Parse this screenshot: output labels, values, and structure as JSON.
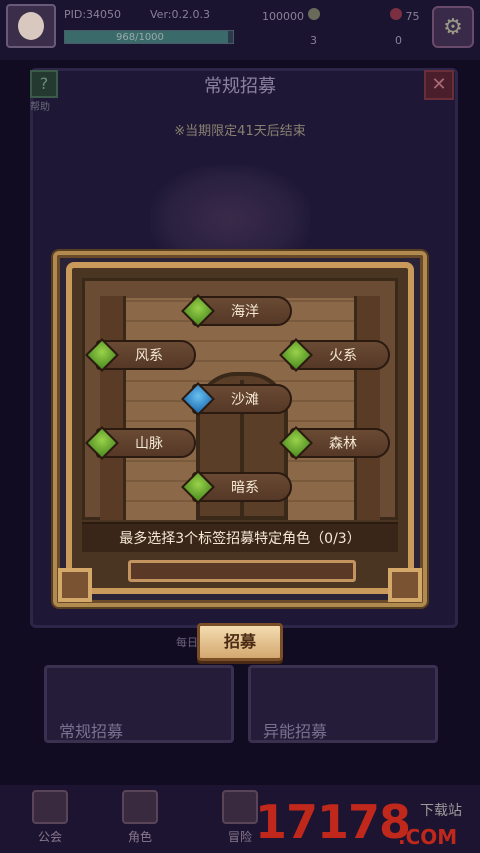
{
  "topbar": {
    "pid": "PID:34050",
    "version": "Ver:0.2.0.3",
    "gold": "100000",
    "res_two": "75",
    "res_three": "3",
    "res_four": "0",
    "exp_text": "968/1000",
    "exp_progress": 0.968
  },
  "background": {
    "title": "常规招募",
    "help_label": "帮助",
    "notice": "※当期限定41天后结束",
    "every_text": "每日...09",
    "card_normal": "常规招募",
    "card_special": "异能招募"
  },
  "nav": {
    "guild": "公会",
    "character": "角色",
    "adventure": "冒险"
  },
  "dialog": {
    "tags": [
      {
        "label": "海洋",
        "gem": "green"
      },
      {
        "label": "风系",
        "gem": "green"
      },
      {
        "label": "火系",
        "gem": "green"
      },
      {
        "label": "沙滩",
        "gem": "blue"
      },
      {
        "label": "山脉",
        "gem": "green"
      },
      {
        "label": "森林",
        "gem": "green"
      },
      {
        "label": "暗系",
        "gem": "green"
      }
    ],
    "info": "最多选择3个标签招募特定角色（0/3）",
    "recruit_button": "招募"
  },
  "watermark": {
    "number": "17178",
    "domain": ".COM",
    "download": "下载站"
  },
  "colors": {
    "frame_gold": "#c99a5a",
    "tag_brown": "#6a4a34",
    "gem_green": "#7ab83a",
    "gem_blue": "#3a8ad0",
    "watermark_red": "#c0281c"
  }
}
